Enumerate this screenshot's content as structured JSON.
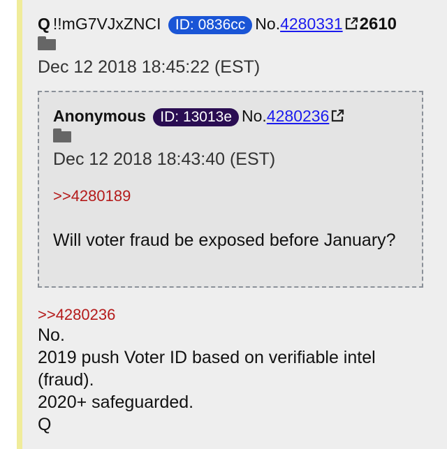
{
  "post": {
    "name": "Q",
    "tripcode": "!!mG7VJxZNCI",
    "id_label": "ID: 0836cc",
    "no_label": "No.",
    "number": "4280331",
    "reply_count": "2610",
    "date": "Dec 12 2018 18:45:22 (EST)",
    "reply_ref": ">>4280236",
    "body_lines": [
      "No.",
      "2019 push Voter ID based on verifiable intel",
      "(fraud).",
      "2020+ safeguarded.",
      "Q"
    ]
  },
  "quoted": {
    "name": "Anonymous",
    "id_label": "ID: 13013e",
    "no_label": "No.",
    "number": "4280236",
    "date": "Dec 12 2018 18:43:40 (EST)",
    "reply_ref": ">>4280189",
    "text": "Will voter fraud be exposed before January?"
  },
  "colors": {
    "id_q": "#1a55d6",
    "id_anon": "#2a0d52",
    "link": "#1a1aee",
    "reply_ref": "#b41a1a",
    "accent_bar": "#f0ec9a"
  },
  "icons": [
    "folder-icon",
    "external-link-icon"
  ]
}
